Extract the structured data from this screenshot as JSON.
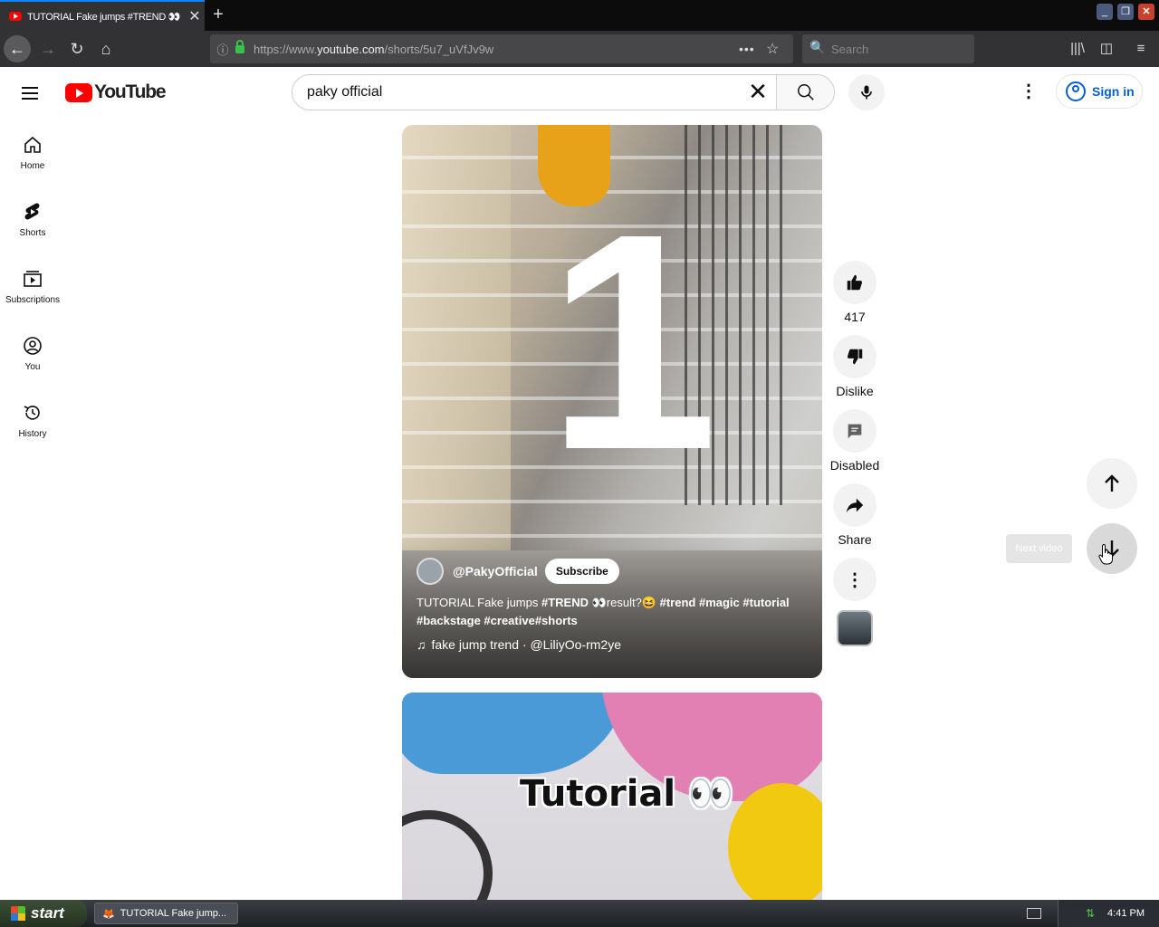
{
  "browser": {
    "tab_title": "TUTORIAL Fake jumps #TREND 👀",
    "url_prefix": "https://www.",
    "url_domain": "youtube.com",
    "url_path": "/shorts/5u7_uVfJv9w",
    "search_placeholder": "Search"
  },
  "youtube": {
    "logo_text": "YouTube",
    "search_value": "paky official",
    "signin_label": "Sign in",
    "guide": [
      {
        "label": "Home",
        "icon": "home-icon"
      },
      {
        "label": "Shorts",
        "icon": "shorts-icon"
      },
      {
        "label": "Subscriptions",
        "icon": "subscriptions-icon"
      },
      {
        "label": "You",
        "icon": "you-icon"
      },
      {
        "label": "History",
        "icon": "history-icon"
      }
    ]
  },
  "short": {
    "overlay_number": "1",
    "channel": "@PakyOfficial",
    "subscribe_label": "Subscribe",
    "description_plain": "TUTORIAL Fake jumps ",
    "description_tag1": "#TREND 👀",
    "description_mid": "result?😆 ",
    "description_tags": "#trend #magic #tutorial #backstage #creative#shorts",
    "music": "fake jump trend · @LiliyOo-rm2ye",
    "likes": "417",
    "dislike_label": "Dislike",
    "comments_label": "Disabled",
    "share_label": "Share"
  },
  "next_short": {
    "caption": "Tutorial 👀"
  },
  "nav": {
    "tooltip": "Next video"
  },
  "taskbar": {
    "start_label": "start",
    "task_label": "TUTORIAL Fake jump...",
    "clock": "4:41 PM"
  }
}
